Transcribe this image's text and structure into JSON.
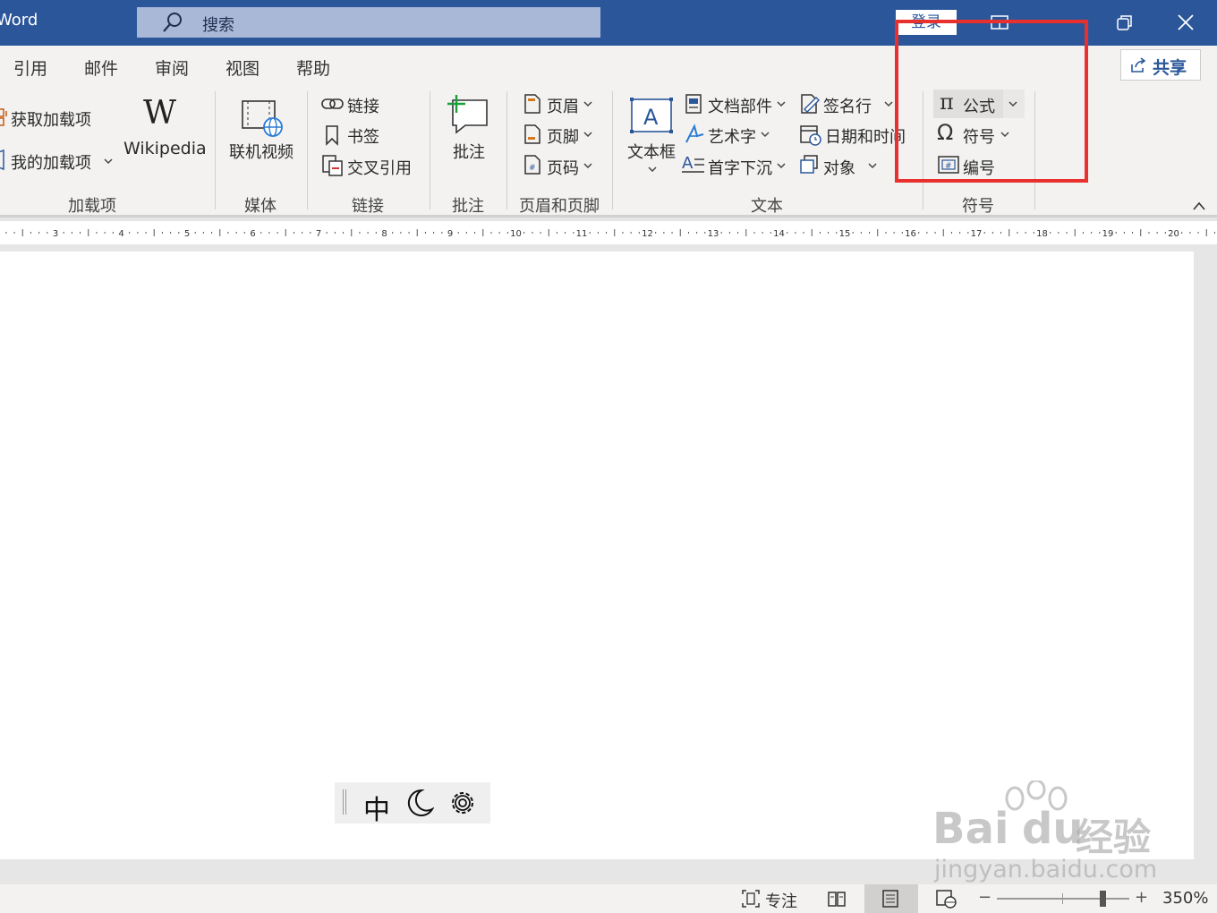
{
  "titlebar": {
    "app_name": "Word",
    "search_placeholder": "搜索",
    "login_label": "登录"
  },
  "tabs": [
    "引用",
    "邮件",
    "审阅",
    "视图",
    "帮助"
  ],
  "share_label": "共享",
  "groups": {
    "addins": {
      "get_addins": "获取加载项",
      "my_addins": "我的加载项",
      "wikipedia": "Wikipedia",
      "label": "加载项"
    },
    "media": {
      "online_video": "联机视频",
      "label": "媒体"
    },
    "links": {
      "link": "链接",
      "bookmark": "书签",
      "cross_ref": "交叉引用",
      "label": "链接"
    },
    "comments": {
      "comment": "批注",
      "label": "批注"
    },
    "header_footer": {
      "header": "页眉",
      "footer": "页脚",
      "page_number": "页码",
      "label": "页眉和页脚"
    },
    "text": {
      "textbox": "文本框",
      "quick_parts": "文档部件",
      "wordart": "艺术字",
      "dropcap": "首字下沉",
      "signature": "签名行",
      "datetime": "日期和时间",
      "object": "对象",
      "label": "文本"
    },
    "symbols": {
      "equation": "公式",
      "symbol": "符号",
      "numbering": "编号",
      "label": "符号"
    }
  },
  "ruler_numbers": [
    "3",
    "4",
    "5",
    "6",
    "7",
    "8",
    "9",
    "10",
    "11",
    "12",
    "13",
    "14",
    "15",
    "16",
    "17",
    "18",
    "19",
    "20"
  ],
  "ime": {
    "mode": "中"
  },
  "status": {
    "focus": "专注",
    "zoom_minus": "−",
    "zoom_plus": "+",
    "zoom_level": "350%"
  },
  "watermark": {
    "brand": "Bai",
    "brand2": "du",
    "cn": "经验",
    "url": "jingyan.baidu.com"
  },
  "colors": {
    "title_bar": "#2b579a",
    "ribbon": "#f3f2f1",
    "highlight": "#e8302f"
  }
}
